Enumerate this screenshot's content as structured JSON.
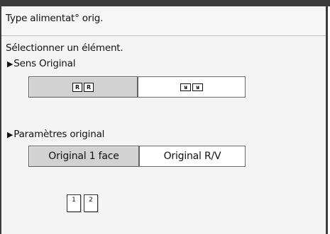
{
  "window": {
    "title": "Type alimentat° orig."
  },
  "prompt": "Sélectionner un élément.",
  "orientation": {
    "label": "Sens Original",
    "buttons": [
      {
        "icon": "portrait-orientation-icon",
        "glyphs": [
          "R",
          "R"
        ],
        "selected": true
      },
      {
        "icon": "landscape-orientation-icon",
        "glyphs": [
          "ᴚ",
          "ᴚ"
        ],
        "selected": false
      }
    ]
  },
  "original_settings": {
    "label": "Paramètres original",
    "buttons": [
      {
        "label": "Original 1 face",
        "selected": true
      },
      {
        "label": "Original R/V",
        "selected": false
      }
    ]
  },
  "page_icons": [
    "1",
    "2"
  ],
  "colors": {
    "frame": "#3c3c3c",
    "selected_button": "#d2d2d2",
    "panel_bg": "#f4f4f4"
  }
}
